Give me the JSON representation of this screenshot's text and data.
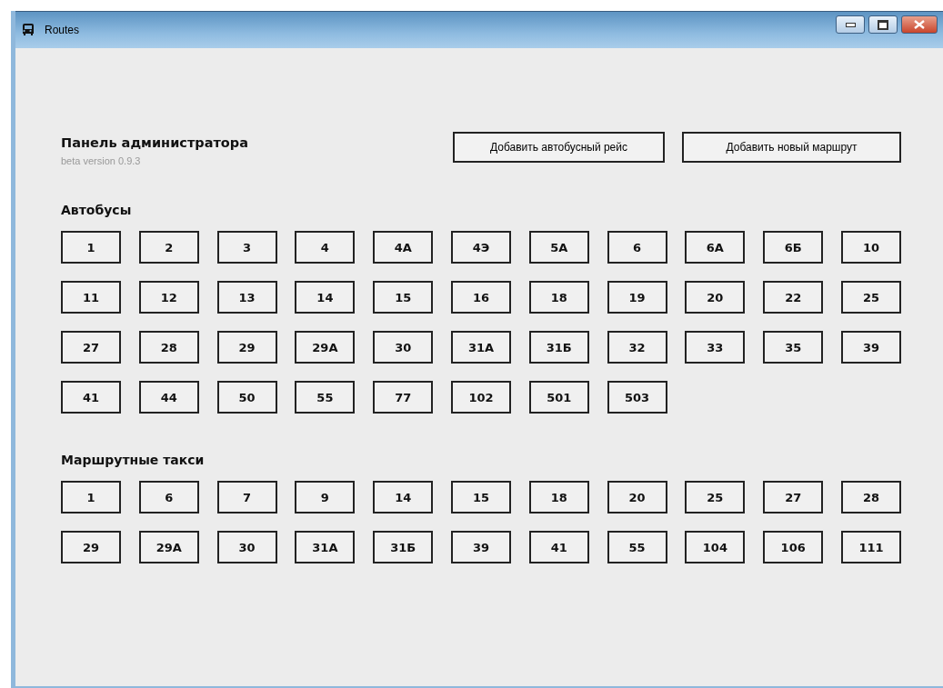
{
  "window": {
    "title": "Routes"
  },
  "header": {
    "title": "Панель администратора",
    "version": "beta version 0.9.3"
  },
  "buttons": [
    "Добавить автобусный рейс",
    "Добавить новый маршрут"
  ],
  "sections": [
    {
      "title": "Автобусы",
      "routes": [
        "1",
        "2",
        "3",
        "4",
        "4А",
        "4Э",
        "5А",
        "6",
        "6А",
        "6Б",
        "10",
        "11",
        "12",
        "13",
        "14",
        "15",
        "16",
        "18",
        "19",
        "20",
        "22",
        "25",
        "27",
        "28",
        "29",
        "29А",
        "30",
        "31А",
        "31Б",
        "32",
        "33",
        "35",
        "39",
        "41",
        "44",
        "50",
        "55",
        "77",
        "102",
        "501",
        "503"
      ]
    },
    {
      "title": "Маршрутные такси",
      "routes": [
        "1",
        "6",
        "7",
        "9",
        "14",
        "15",
        "18",
        "20",
        "25",
        "27",
        "28",
        "29",
        "29А",
        "30",
        "31А",
        "31Б",
        "39",
        "41",
        "55",
        "104",
        "106",
        "111"
      ]
    }
  ]
}
